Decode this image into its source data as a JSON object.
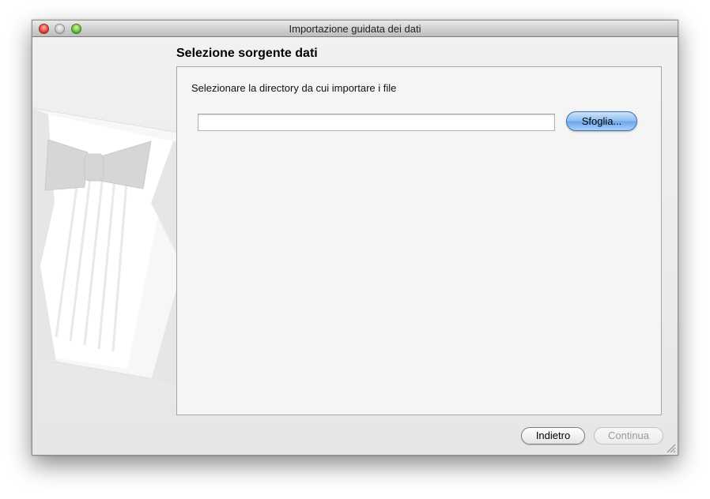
{
  "window": {
    "title": "Importazione guidata dei dati"
  },
  "page": {
    "section_title": "Selezione sorgente dati",
    "instruction": "Selezionare la directory da cui importare i file",
    "directory_input": {
      "value": "",
      "placeholder": ""
    },
    "browse_label": "Sfoglia..."
  },
  "footer": {
    "back_label": "Indietro",
    "continue_label": "Continua",
    "continue_enabled": false
  },
  "icons": {
    "close": "close-icon",
    "minimize": "minimize-icon",
    "zoom": "zoom-icon",
    "illustration": "tuxedo-illustration",
    "resize": "resize-grip-icon"
  },
  "colors": {
    "accent": "#6aa6ea",
    "close": "#e94b3f",
    "minimize": "#c9c9c9",
    "zoom": "#6fc43e"
  }
}
